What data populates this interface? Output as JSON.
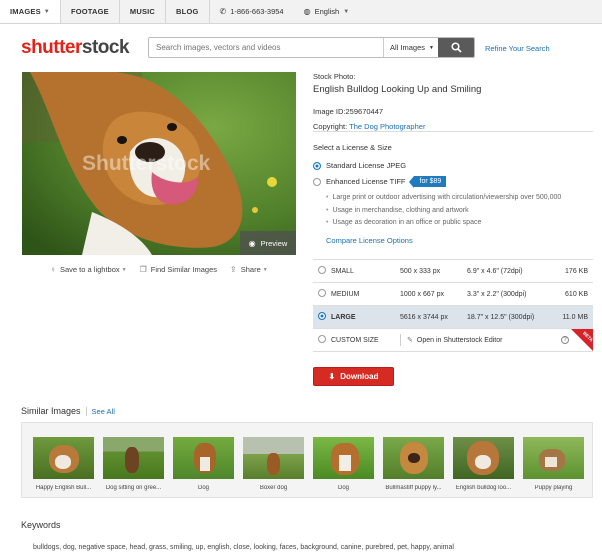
{
  "topnav": {
    "tabs": [
      "IMAGES",
      "FOOTAGE",
      "MUSIC",
      "BLOG"
    ],
    "phone": "1-866-663-3954",
    "language": "English"
  },
  "header": {
    "logo_part1": "shutter",
    "logo_part2": "stock",
    "search_placeholder": "Search images, vectors and videos",
    "search_scope": "All Images",
    "refine_link": "Refine Your Search"
  },
  "photo": {
    "watermark": "Shutterstock",
    "preview_label": "Preview",
    "actions": [
      "Save to a lightbox",
      "Find Similar Images",
      "Share"
    ]
  },
  "info": {
    "type_label": "Stock Photo:",
    "title": "English Bulldog Looking Up and Smiling",
    "image_id": "Image ID:259670447",
    "copyright_label": "Copyright:",
    "copyright_name": "The Dog Photographer"
  },
  "license": {
    "heading": "Select a License & Size",
    "standard": "Standard License JPEG",
    "enhanced": "Enhanced License TIFF",
    "enhanced_price": "for $89",
    "bullets": [
      "Large print or outdoor advertising with circulation/viewership over 500,000",
      "Usage in merchandise, clothing and artwork",
      "Usage as decoration in an office or public space"
    ],
    "compare_link": "Compare License Options"
  },
  "sizes": [
    {
      "name": "SMALL",
      "px": "500 x 333 px",
      "inches": "6.9\" x 4.6\" (72dpi)",
      "file": "176 KB",
      "selected": false
    },
    {
      "name": "MEDIUM",
      "px": "1000 x 667 px",
      "inches": "3.3\" x 2.2\" (300dpi)",
      "file": "610 KB",
      "selected": false
    },
    {
      "name": "LARGE",
      "px": "5616 x 3744 px",
      "inches": "18.7\" x 12.5\" (300dpi)",
      "file": "11.0 MB",
      "selected": true
    }
  ],
  "custom": {
    "name": "CUSTOM SIZE",
    "editor": "Open in Shutterstock Editor",
    "help": "?",
    "badge": "BETA"
  },
  "download_label": "Download",
  "similar": {
    "heading": "Similar Images",
    "see_all": "See All",
    "captions": [
      "Happy English Bull...",
      "Dog sitting on gree...",
      "Dog",
      "Boxer dog",
      "Dog",
      "Bullmastiff puppy ly...",
      "English bulldog loo...",
      "Puppy playing"
    ]
  },
  "keywords": {
    "heading": "Keywords",
    "list": "bulldogs, dog, negative space, head, grass, smiling, up, english, close, looking, faces, background, canine, purebred, pet, happy, animal"
  },
  "colors": {
    "brand_red": "#e2231a",
    "link_blue": "#1a6fb5",
    "download_red": "#d62b22",
    "selected_row": "#dde3ea"
  }
}
